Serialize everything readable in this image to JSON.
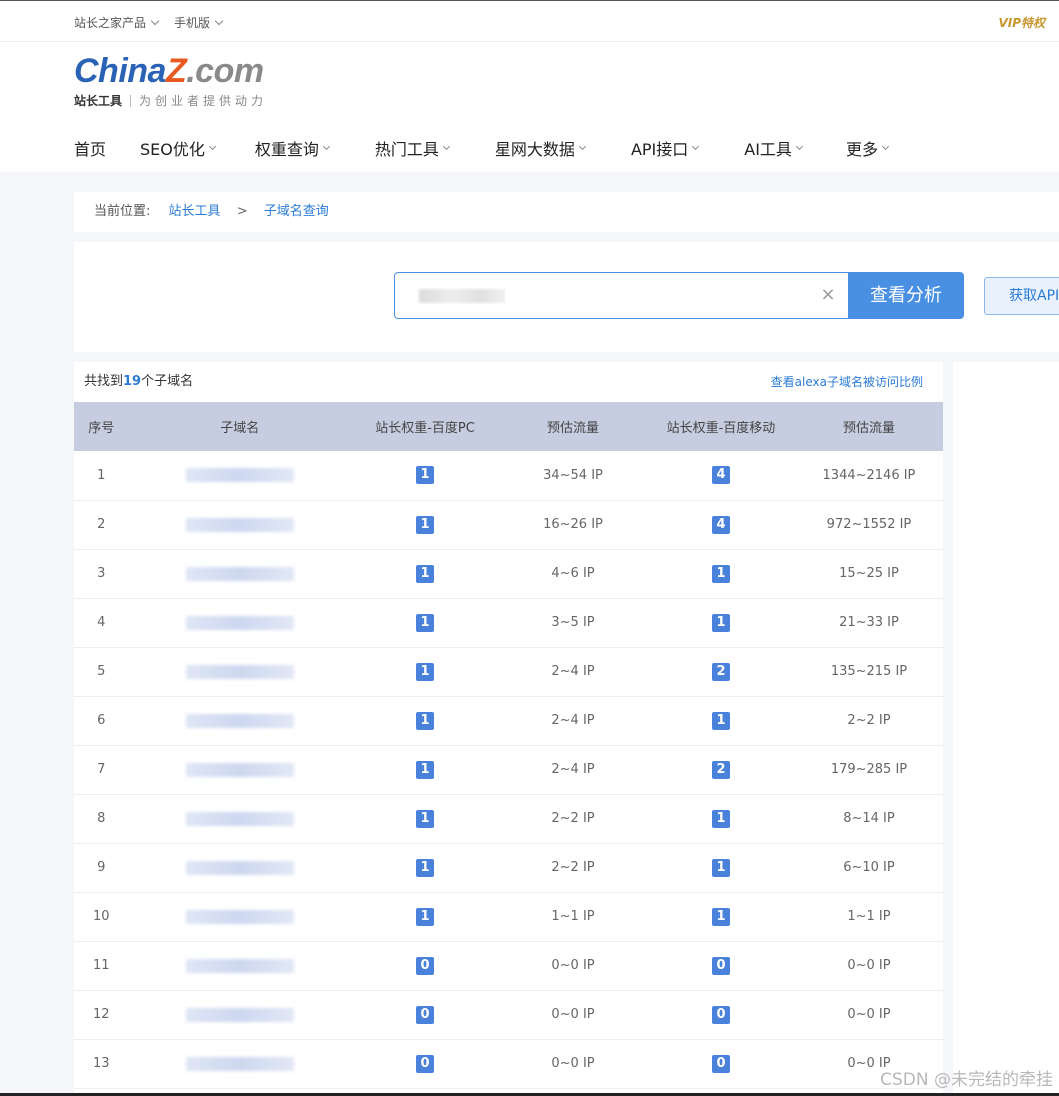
{
  "topbar": {
    "links": [
      "站长之家产品",
      "手机版"
    ],
    "vip": "VIP特权"
  },
  "logo": {
    "part1": "China",
    "part2": "Z",
    "part3": ".com",
    "sub": "站长工具",
    "slogan": "为创业者提供动力"
  },
  "nav": [
    {
      "label": "首页",
      "dropdown": false
    },
    {
      "label": "SEO优化",
      "dropdown": true
    },
    {
      "label": "权重查询",
      "dropdown": true
    },
    {
      "label": "热门工具",
      "dropdown": true
    },
    {
      "label": "星网大数据",
      "dropdown": true
    },
    {
      "label": "API接口",
      "dropdown": true
    },
    {
      "label": "AI工具",
      "dropdown": true
    },
    {
      "label": "更多",
      "dropdown": true
    }
  ],
  "breadcrumb": {
    "prefix": "当前位置:",
    "items": [
      "站长工具",
      "子域名查询"
    ],
    "separator": ">"
  },
  "search": {
    "button": "查看分析",
    "api_button": "获取API"
  },
  "result": {
    "prefix": "共找到",
    "count": "19",
    "suffix": "个子域名",
    "link": "查看alexa子域名被访问比例",
    "columns": [
      "序号",
      "子域名",
      "站长权重-百度PC",
      "预估流量",
      "站长权重-百度移动",
      "预估流量"
    ],
    "rows": [
      {
        "idx": "1",
        "pc": "1",
        "pc_flow": "34~54 IP",
        "m": "4",
        "m_flow": "1344~2146 IP"
      },
      {
        "idx": "2",
        "pc": "1",
        "pc_flow": "16~26 IP",
        "m": "4",
        "m_flow": "972~1552 IP"
      },
      {
        "idx": "3",
        "pc": "1",
        "pc_flow": "4~6 IP",
        "m": "1",
        "m_flow": "15~25 IP"
      },
      {
        "idx": "4",
        "pc": "1",
        "pc_flow": "3~5 IP",
        "m": "1",
        "m_flow": "21~33 IP"
      },
      {
        "idx": "5",
        "pc": "1",
        "pc_flow": "2~4 IP",
        "m": "2",
        "m_flow": "135~215 IP"
      },
      {
        "idx": "6",
        "pc": "1",
        "pc_flow": "2~4 IP",
        "m": "1",
        "m_flow": "2~2 IP"
      },
      {
        "idx": "7",
        "pc": "1",
        "pc_flow": "2~4 IP",
        "m": "2",
        "m_flow": "179~285 IP"
      },
      {
        "idx": "8",
        "pc": "1",
        "pc_flow": "2~2 IP",
        "m": "1",
        "m_flow": "8~14 IP"
      },
      {
        "idx": "9",
        "pc": "1",
        "pc_flow": "2~2 IP",
        "m": "1",
        "m_flow": "6~10 IP"
      },
      {
        "idx": "10",
        "pc": "1",
        "pc_flow": "1~1 IP",
        "m": "1",
        "m_flow": "1~1 IP"
      },
      {
        "idx": "11",
        "pc": "0",
        "pc_flow": "0~0 IP",
        "m": "0",
        "m_flow": "0~0 IP"
      },
      {
        "idx": "12",
        "pc": "0",
        "pc_flow": "0~0 IP",
        "m": "0",
        "m_flow": "0~0 IP"
      },
      {
        "idx": "13",
        "pc": "0",
        "pc_flow": "0~0 IP",
        "m": "0",
        "m_flow": "0~0 IP"
      }
    ]
  },
  "watermark": "CSDN @未完结的牵挂",
  "colors": {
    "accent": "#4a90e2",
    "link": "#2b7bd6",
    "badge": "#4a82db",
    "table_header": "#c6cde0"
  }
}
